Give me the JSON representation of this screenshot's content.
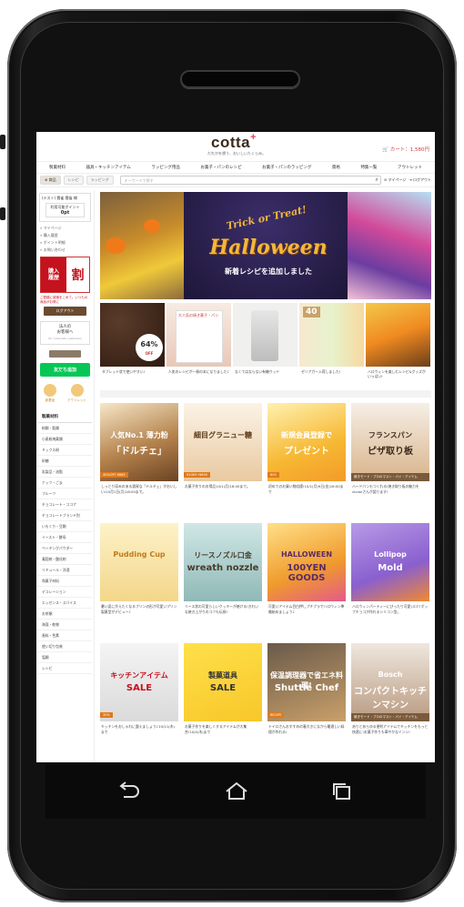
{
  "site": {
    "logo_text": "cotta",
    "logo_plus": "+",
    "tagline": "だれかを想う、おいしいたくらみ。",
    "cart": "🛒 カート：1,580円"
  },
  "catnav": [
    "製菓材料",
    "器具・キッチンアイテム",
    "ラッピング用品",
    "お菓子・パンのレシピ",
    "お菓子・パンのラッピング",
    "資格",
    "特集一覧",
    "アウトレット"
  ],
  "search": {
    "tabs": [
      "⊕ 商品",
      "レシピ",
      "ラッピング"
    ],
    "placeholder": "キーワードで探す",
    "mypage": "⊖ マイページ",
    "logout": "⇥ ログアウト"
  },
  "sidebar": {
    "user": "(テスト) 雲雀 雲雀 様",
    "points_label": "利用可能ポイント",
    "points": "0pt",
    "links": [
      "» マイページ",
      "» 購入履歴",
      "» ポイント明細",
      "» お問い合わせ"
    ],
    "promo_left_1": "購入",
    "promo_left_2": "履歴",
    "promo_right": "割",
    "promo_sub": "ご愛顧に感謝をこめて。いつもの商品がお得に",
    "logout": "ログアウト",
    "corp_1": "法人の",
    "corp_2": "お客様へ",
    "corp_en": "for corporate customers",
    "line": "友だち追加",
    "icon_1": "新着品",
    "icon_2": "アウトレット",
    "cat_head": "製菓材料",
    "cats": [
      "粉類・穀類",
      "小麦粉焼菓類",
      "ミックス粉",
      "砂糖",
      "乳製品・油脂",
      "ナッツ・ごま",
      "フルーツ",
      "チョコレート・ココア",
      "チョコレートブランド別",
      "いもくり・豆類",
      "イースト・酵母",
      "ベーキングパウダー",
      "凝固剤・酸化剤",
      "リキュール・洋酒",
      "和菓子材料",
      "デコレーション",
      "エッセンス・スパイス",
      "お茶類",
      "海藻・乾物",
      "香料・色素",
      "使い切り包装",
      "塩類",
      "レシピ"
    ]
  },
  "hero": {
    "trick": "Trick or Treat!",
    "title": "Halloween",
    "subtitle": "新着レシピを追加しました"
  },
  "strip": [
    {
      "caption": "タブレット状で使いやすい!",
      "badge": "64%",
      "badge_sub": "OFF"
    },
    {
      "caption": "人気のレシピが一冊の本になりました♪",
      "label": "大人気の焼き菓子・パン"
    },
    {
      "caption": "なくてはならない有機ウッド",
      "label": ""
    },
    {
      "caption": "ゼリアガー入荷しました!",
      "label": "40"
    },
    {
      "caption": "ハロウィンを楽しむレシピ&グッズがいっぱい!",
      "label": ""
    }
  ],
  "cards": [
    {
      "caption": "しっとり深みのある濃厚な「ドルチェ」がおいしい!10月1日(月)16:00まで。",
      "l1": "人気No.1 薄力粉",
      "l2": "「ドルチェ」",
      "price": "40%OFF ¥665"
    },
    {
      "caption": "お菓子作りのお得品10/1(月)16:00まで。",
      "l1": "細目グラニュー糖",
      "l2": "",
      "price": "¥1063→¥690"
    },
    {
      "caption": "初めてのお買い物応援!10/1(月)9日(金)16:00まで",
      "l1": "新規会員登録で",
      "l2": "プレゼント",
      "price": "600"
    },
    {
      "caption": "ハードパンもつくれる!焼き取り板の魅力をvivianさんが語ります!",
      "l1": "フランスパン",
      "l2": "ピザ取り板",
      "price": "焼きモード・プロのマスト・パイ・アイテム"
    },
    {
      "caption": "暑い夏に冷えたくなるプリンの形が可愛いプリン製菓型がデビュー♪",
      "l1": "Pudding Cup",
      "l2": "",
      "price": ""
    },
    {
      "caption": "リース状の可愛らしいクッキーが焼ける!きれいな焼き上がりのコツも伝授!",
      "l1": "リースノズル口金",
      "l2": "wreath nozzle",
      "price": ""
    },
    {
      "caption": "可愛いアイテム目白押しプチプラでハロウィン準備始めましょう♪",
      "l1": "HALLOWEEN",
      "l2": "100YEN GOODS",
      "price": ""
    },
    {
      "caption": "ハロウィンパーティーにぴったり可愛いロリポップチョコが作れるシリコン型。",
      "l1": "Lollipop",
      "l2": "Mold",
      "price": ""
    },
    {
      "caption": "キッチンをおしゃれに整えましょう♪10/11(木)まで",
      "l1": "キッチンアイテム",
      "l2": "SALE",
      "price": "30%"
    },
    {
      "caption": "お菓子作りを楽しくするアイテムが大集合!10/4(木)まで",
      "l1": "製菓道具",
      "l2": "SALE",
      "price": ""
    },
    {
      "caption": "トイロさんおすすめの春大きになから最適しい料理が作れる!",
      "l1": "保温調理器で省エネ料理!",
      "l2": "Shuttle Chef",
      "price": "RECIPE"
    },
    {
      "caption": "ありとあらゆる便利アイテムでキッチンをもっと快適に!お菓子作りも華やかなインシ!",
      "l1": "Bosch",
      "l2": "コンパクトキッチンマシン",
      "price": "焼きモード・プロのマスト・パイ・アイテム"
    }
  ]
}
